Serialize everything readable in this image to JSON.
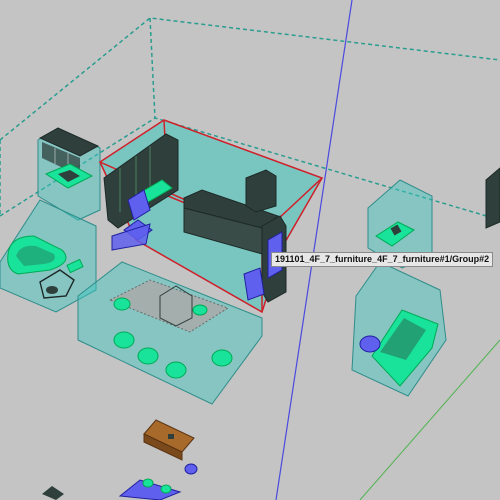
{
  "viewport": {
    "background_color": "#c4c4c4",
    "tooltip": {
      "text": "191101_4F_7_furniture_4F_7_furniture#1/Group#2"
    }
  },
  "colors": {
    "room_outline": "#2a9d8f",
    "volume_fill": "#3cc8c0",
    "volume_edge": "#2e8d8a",
    "furniture_green": "#19e39a",
    "furniture_dark": "#2f3f3b",
    "selection_red": "#d0202a",
    "selected_blue": "#6060ee",
    "axis_blue": "#4a4ae0",
    "axis_green": "#4fb24f",
    "wood": "#a86a2a"
  }
}
